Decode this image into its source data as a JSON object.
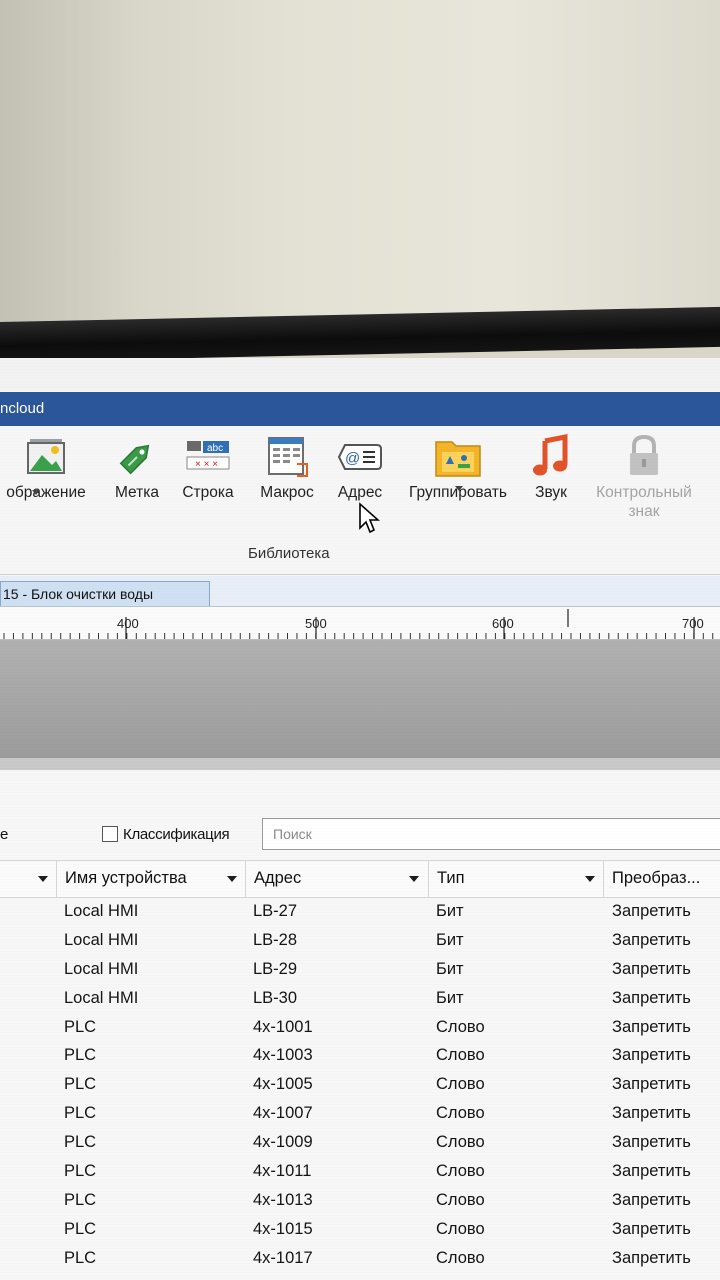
{
  "window": {
    "title": "ncloud"
  },
  "ribbon": {
    "buttons": [
      {
        "label": "ображение",
        "icon": "image-icon"
      },
      {
        "label": "Метка",
        "icon": "tag-icon"
      },
      {
        "label": "Строка",
        "icon": "string-table-icon"
      },
      {
        "label": "Макрос",
        "icon": "macro-icon"
      },
      {
        "label": "Адрес",
        "icon": "address-icon"
      },
      {
        "label": "Группировать",
        "icon": "group-icon"
      },
      {
        "label": "Звук",
        "icon": "music-note-icon"
      },
      {
        "label_line1": "Контрольный",
        "label_line2": "знак",
        "icon": "lock-icon",
        "disabled": true
      }
    ],
    "group_label": "Библиотека"
  },
  "tabs": {
    "active": "15 - Блок очистки  воды"
  },
  "ruler": {
    "labels": [
      "400",
      "500",
      "600",
      "700"
    ]
  },
  "filter": {
    "left_cut": "е",
    "classification_label": "Классификация",
    "search_placeholder": "Поиск"
  },
  "table": {
    "columns": [
      "Имя устройства",
      "Адрес",
      "Тип",
      "Преобраз..."
    ],
    "rows": [
      [
        "Local HMI",
        "LB-27",
        "Бит",
        "Запретить"
      ],
      [
        "Local HMI",
        "LB-28",
        "Бит",
        "Запретить"
      ],
      [
        "Local HMI",
        "LB-29",
        "Бит",
        "Запретить"
      ],
      [
        "Local HMI",
        "LB-30",
        "Бит",
        "Запретить"
      ],
      [
        "PLC",
        "4x-1001",
        "Слово",
        "Запретить"
      ],
      [
        "PLC",
        "4x-1003",
        "Слово",
        "Запретить"
      ],
      [
        "PLC",
        "4x-1005",
        "Слово",
        "Запретить"
      ],
      [
        "PLC",
        "4x-1007",
        "Слово",
        "Запретить"
      ],
      [
        "PLC",
        "4x-1009",
        "Слово",
        "Запретить"
      ],
      [
        "PLC",
        "4x-1011",
        "Слово",
        "Запретить"
      ],
      [
        "PLC",
        "4x-1013",
        "Слово",
        "Запретить"
      ],
      [
        "PLC",
        "4x-1015",
        "Слово",
        "Запретить"
      ],
      [
        "PLC",
        "4x-1017",
        "Слово",
        "Запретить"
      ]
    ]
  },
  "colors": {
    "titlebar": "#2b579a",
    "tab_active": "#cfe0f3",
    "canvas": "#a8a8a8"
  }
}
